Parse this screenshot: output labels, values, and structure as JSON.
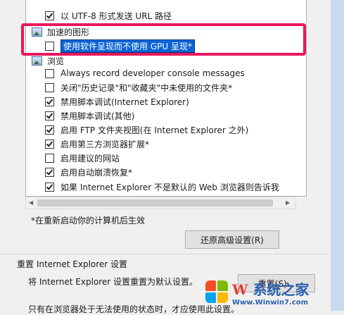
{
  "settings_list": {
    "items": [
      {
        "type": "checkbox",
        "checked": true,
        "label": "以 UTF-8 形式发送 URL 路径"
      },
      {
        "type": "category",
        "label": "加速的图形"
      },
      {
        "type": "checkbox",
        "checked": false,
        "label": "使用软件呈现而不使用 GPU 呈现*",
        "selected": true
      },
      {
        "type": "category",
        "label": "浏览"
      },
      {
        "type": "checkbox",
        "checked": false,
        "label": "Always record developer console messages"
      },
      {
        "type": "checkbox",
        "checked": false,
        "label": "关闭\"历史记录\"和\"收藏夹\"中未使用的文件夹*"
      },
      {
        "type": "checkbox",
        "checked": true,
        "label": "禁用脚本调试(Internet Explorer)"
      },
      {
        "type": "checkbox",
        "checked": true,
        "label": "禁用脚本调试(其他)"
      },
      {
        "type": "checkbox",
        "checked": true,
        "label": "启用 FTP 文件夹视图(在 Internet Explorer 之外)"
      },
      {
        "type": "checkbox",
        "checked": true,
        "label": "启用第三方浏览器扩展*"
      },
      {
        "type": "checkbox",
        "checked": false,
        "label": "启用建议的网站"
      },
      {
        "type": "checkbox",
        "checked": true,
        "label": "启用自动崩溃恢复*"
      },
      {
        "type": "checkbox",
        "checked": true,
        "label": "如果 Internet Explorer 不是默认的 Web 浏览器则告诉我"
      }
    ]
  },
  "restart_note": "*在重新启动你的计算机后生效",
  "restore_advanced_button": "还原高级设置(R)",
  "reset_section": {
    "title": "重置 Internet Explorer 设置",
    "description": "将 Internet Explorer 设置重置为默认设置。",
    "button": "重置(S)..."
  },
  "partial_text": "只有在浏览器处于无法使用的状态时，才应使用此设置。",
  "watermark": {
    "title": "系统之家",
    "title_prefix": "W",
    "url": "Www.Winwin7.com"
  }
}
